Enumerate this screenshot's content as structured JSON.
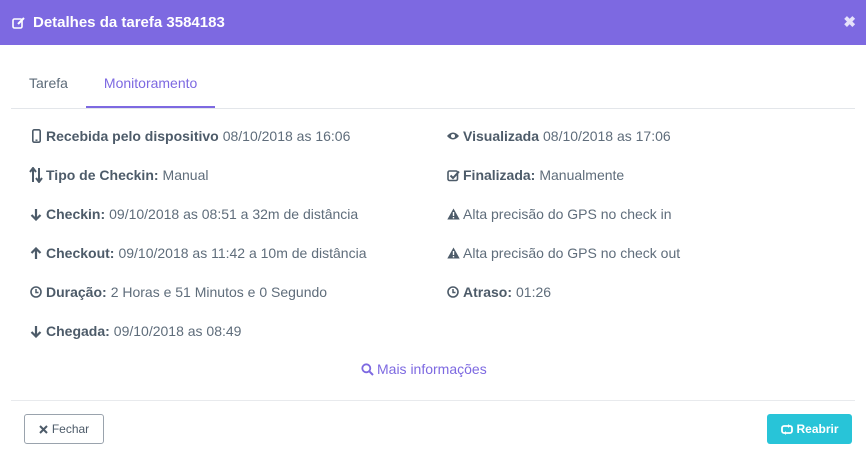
{
  "header": {
    "title": "Detalhes da tarefa 3584183",
    "close_glyph": "✖"
  },
  "tabs": [
    {
      "label": "Tarefa",
      "active": false
    },
    {
      "label": "Monitoramento",
      "active": true
    }
  ],
  "details": {
    "received": {
      "label": "Recebida pelo dispositivo",
      "value": "08/10/2018 as 16:06",
      "icon": "mobile-icon"
    },
    "viewed": {
      "label": "Visualizada",
      "value": "08/10/2018 as 17:06",
      "icon": "eye-icon"
    },
    "checkin_type": {
      "label": "Tipo de Checkin:",
      "value": "Manual",
      "icon": "sort-arrows-icon"
    },
    "finished": {
      "label": "Finalizada:",
      "value": "Manualmente",
      "icon": "check-square-icon"
    },
    "checkin": {
      "label": "Checkin:",
      "value": "09/10/2018 as 08:51 a 32m de distância",
      "icon": "arrow-down-icon"
    },
    "gps_in": {
      "text": "Alta precisão do GPS no check in",
      "icon": "warning-icon"
    },
    "checkout": {
      "label": "Checkout:",
      "value": "09/10/2018 as 11:42 a 10m de distância",
      "icon": "arrow-up-icon"
    },
    "gps_out": {
      "text": "Alta precisão do GPS no check out",
      "icon": "warning-icon"
    },
    "duration": {
      "label": "Duração:",
      "value": "2 Horas e 51 Minutos e 0 Segundo",
      "icon": "clock-icon"
    },
    "delay": {
      "label": "Atraso:",
      "value": "01:26",
      "icon": "clock-icon"
    },
    "arrival": {
      "label": "Chegada:",
      "value": "09/10/2018 as 08:49",
      "icon": "arrow-down-icon"
    }
  },
  "more_info": "Mais informações",
  "footer": {
    "close_label": "Fechar",
    "reopen_label": "Reabrir"
  },
  "colors": {
    "header": "#7d69e1",
    "accent": "#7d69e1",
    "reopen": "#28c4d8"
  }
}
